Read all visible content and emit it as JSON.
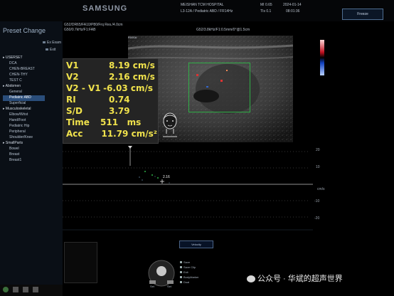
{
  "header": {
    "brand": "SAMSUNG",
    "hospital": "MEISHAN TCM HOSPITAL",
    "probe_preset": "L3-12A / Pediatric ABD / FR14Hz",
    "mi": "MI 0.65",
    "ti": "TIs 0.1",
    "date": "2024-01-14",
    "time": "08:01:36",
    "left_line1": "G52/DR65/FA10/P80/Frq Res./4.0cm",
    "left_line2": "G50/0.7kHz/F1:FAB",
    "right_line": "G52/3.8kHz/F1:0.5mm/0°@1.5cm",
    "freeze_label": "Freeze"
  },
  "sidebar": {
    "title": "Preset Change",
    "ex_exam": "Ex Exam",
    "exit": "Exit",
    "items": [
      {
        "label": "USERSET",
        "type": "category"
      },
      {
        "label": "DCA",
        "type": "item"
      },
      {
        "label": "CHEN-BREAST",
        "type": "item"
      },
      {
        "label": "CHEN-THY",
        "type": "item"
      },
      {
        "label": "TEST C",
        "type": "item"
      },
      {
        "label": "Abdomen",
        "type": "category"
      },
      {
        "label": "General",
        "type": "item"
      },
      {
        "label": "Pediatric ABD",
        "type": "selected"
      },
      {
        "label": "Superficial",
        "type": "item"
      },
      {
        "label": "Musculoskeletal",
        "type": "category"
      },
      {
        "label": "Elbow/Wrist",
        "type": "item"
      },
      {
        "label": "Hand/Foot",
        "type": "item"
      },
      {
        "label": "Pediatric Hip",
        "type": "item"
      },
      {
        "label": "Peripheral",
        "type": "item"
      },
      {
        "label": "Shoulder/Knee",
        "type": "item"
      },
      {
        "label": "SmallParts",
        "type": "category"
      },
      {
        "label": "Bowel",
        "type": "item"
      },
      {
        "label": "Breast",
        "type": "item"
      },
      {
        "label": "Breast1",
        "type": "item"
      }
    ]
  },
  "measurements": [
    {
      "label": "V1",
      "value": "8.19 cm/s"
    },
    {
      "label": "V2",
      "value": "2.16 cm/s"
    },
    {
      "label": "V2 - V1",
      "value": "-6.03 cm/s"
    },
    {
      "label": "RI",
      "value": "0.74"
    },
    {
      "label": "S/D",
      "value": "3.79"
    },
    {
      "label": "Time",
      "value": "511   ms"
    },
    {
      "label": "Acc",
      "value": "11.79 cm/s²"
    }
  ],
  "image_labels": {
    "probe_tag": "R000A",
    "doppler_marker": "2.16",
    "body_mark": "head-bodymark-icon"
  },
  "doppler_scale": {
    "unit": "cm/s",
    "ticks": [
      "20",
      "10",
      "",
      "-10",
      "-20"
    ]
  },
  "velocity_button": "Velocity",
  "control_labels": [
    "Save",
    "Save Clip",
    "Exit",
    "BodyMarker",
    "Dual",
    "Set",
    "Set"
  ],
  "watermark": "公众号 · 华斌的超声世界",
  "colors": {
    "measurement_text": "#f0e24c",
    "roi_box": "#2fae46",
    "selected_preset": "#2a4d7a"
  }
}
